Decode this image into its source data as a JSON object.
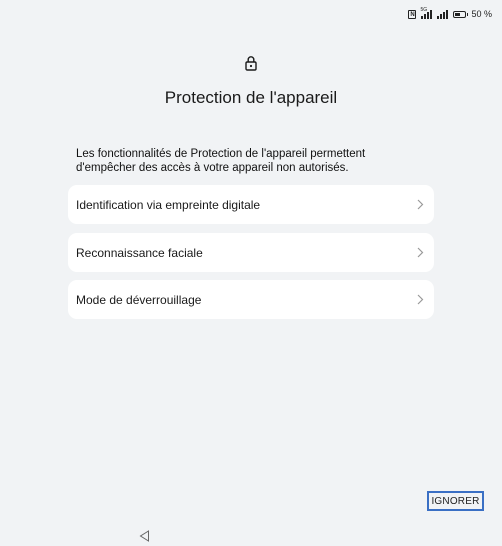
{
  "status_bar": {
    "nfc_label": "N",
    "signal_tag": "5G",
    "battery_text": "50 %",
    "battery_level": 0.5
  },
  "header": {
    "icon": "lock-icon",
    "title": "Protection de l'appareil"
  },
  "description": "Les fonctionnalités de Protection de l'appareil permettent d'empêcher des accès à votre appareil non autorisés.",
  "options": [
    {
      "label": "Identification via empreinte digitale",
      "icon": "chevron-right-icon"
    },
    {
      "label": "Reconnaissance faciale",
      "icon": "chevron-right-icon"
    },
    {
      "label": "Mode de déverrouillage",
      "icon": "chevron-right-icon"
    }
  ],
  "footer": {
    "ignore_label": "IGNORER"
  },
  "navigation": {
    "back_icon": "back-triangle-icon"
  }
}
